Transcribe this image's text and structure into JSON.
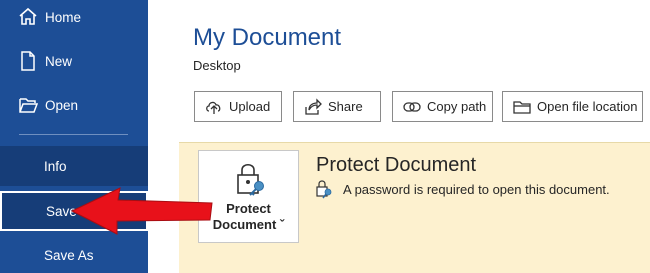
{
  "sidebar": {
    "items": [
      {
        "label": "Home",
        "icon": "home-icon"
      },
      {
        "label": "New",
        "icon": "new-document-icon"
      },
      {
        "label": "Open",
        "icon": "folder-open-icon"
      },
      {
        "label": "Info"
      },
      {
        "label": "Save"
      },
      {
        "label": "Save As"
      }
    ],
    "background_color": "#1d4e96"
  },
  "document": {
    "title": "My Document",
    "location": "Desktop"
  },
  "actions": [
    {
      "label": "Upload",
      "icon": "upload-icon"
    },
    {
      "label": "Share",
      "icon": "share-icon"
    },
    {
      "label": "Copy path",
      "icon": "link-icon"
    },
    {
      "label": "Open file location",
      "icon": "folder-icon"
    }
  ],
  "protect": {
    "button_line1": "Protect",
    "button_line2": "Document ˇ",
    "heading": "Protect Document",
    "description": "A password is required to open this document.",
    "panel_color": "#fdf1cf"
  },
  "annotation": {
    "arrow_color": "#e8111a"
  }
}
